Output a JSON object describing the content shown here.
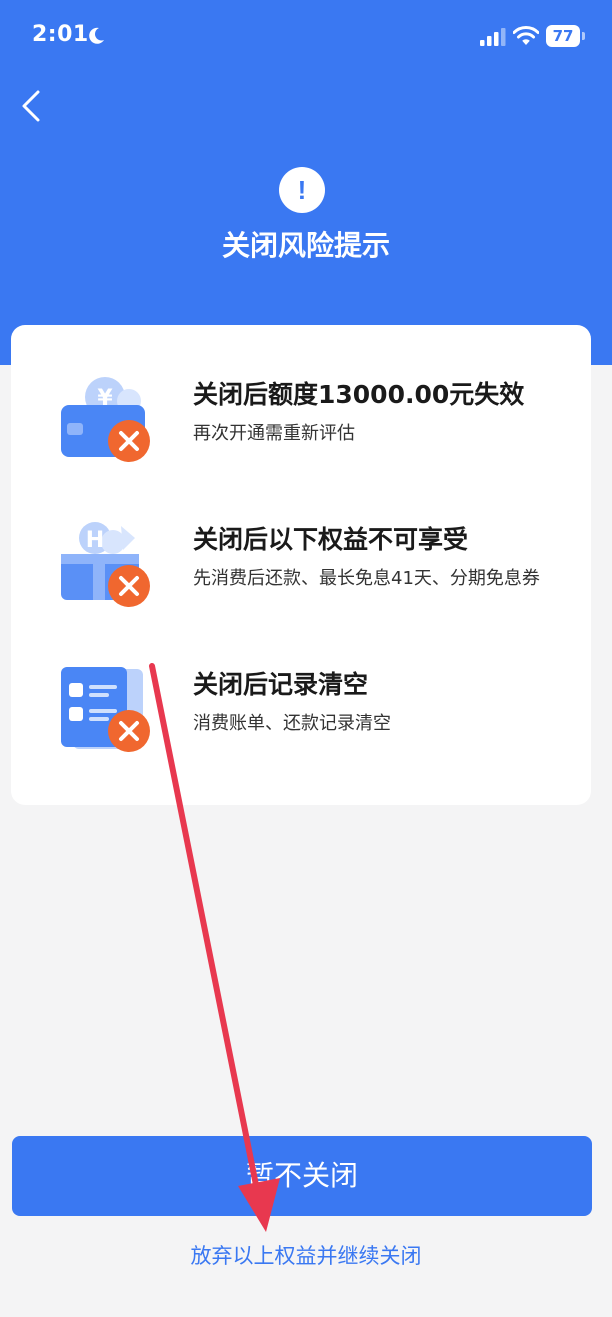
{
  "status_bar": {
    "time": "2:01",
    "battery": "77",
    "icons": [
      "moon-icon",
      "signal-icon",
      "wifi-icon",
      "battery-icon"
    ]
  },
  "header": {
    "back_icon": "chevron-left-icon",
    "alert_icon": "exclamation-icon",
    "alert_glyph": "!",
    "title": "关闭风险提示",
    "color": "#3a78f2"
  },
  "risks": [
    {
      "icon": "wallet-yuan-icon",
      "title": "关闭后额度13000.00元失效",
      "desc": "再次开通需重新评估"
    },
    {
      "icon": "gift-bag-icon",
      "title": "关闭后以下权益不可享受",
      "desc": "先消费后还款、最长免息41天、分期免息券"
    },
    {
      "icon": "record-document-icon",
      "title": "关闭后记录清空",
      "desc": "消费账单、还款记录清空"
    }
  ],
  "actions": {
    "keep_label": "暂不关闭",
    "giveup_label": "放弃以上权益并继续关闭"
  },
  "colors": {
    "primary": "#3a78f2",
    "warning": "#f0672f",
    "annotation": "#e8384f"
  }
}
